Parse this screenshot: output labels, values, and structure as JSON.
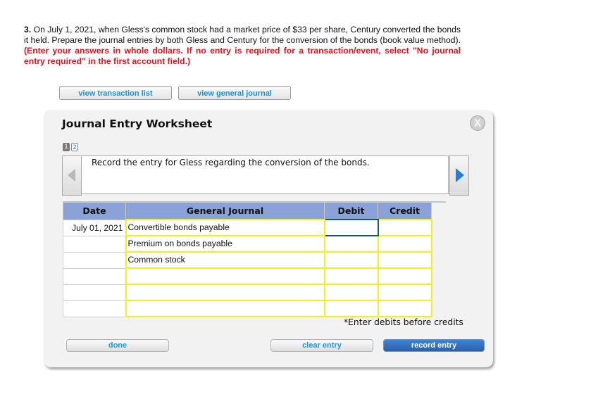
{
  "question": {
    "number": "3.",
    "text": "On July 1, 2021, when Gless's common stock had a market price of $33 per share, Century converted the bonds it held. Prepare the journal entries by both Gless and Century for the conversion of the bonds (book value method).",
    "instructions": "(Enter your answers in whole dollars. If no entry is required for a transaction/event, select \"No journal entry required\" in the first account field.)"
  },
  "top_buttons": {
    "view_transaction_list": "view transaction list",
    "view_general_journal": "view general journal"
  },
  "dialog": {
    "title": "Journal Entry Worksheet",
    "close_icon": "X",
    "pages": [
      {
        "label": "1",
        "active": true
      },
      {
        "label": "2",
        "active": false
      }
    ],
    "instruction_text": "Record the entry for Gless regarding the conversion of the bonds.",
    "table": {
      "headers": [
        "Date",
        "General Journal",
        "Debit",
        "Credit"
      ],
      "rows": [
        {
          "date": "July 01, 2021",
          "account": "Convertible bonds payable",
          "debit": "",
          "credit": ""
        },
        {
          "date": "",
          "account": "Premium on bonds payable",
          "debit": "",
          "credit": ""
        },
        {
          "date": "",
          "account": "Common stock",
          "debit": "",
          "credit": ""
        },
        {
          "date": "",
          "account": "",
          "debit": "",
          "credit": ""
        },
        {
          "date": "",
          "account": "",
          "debit": "",
          "credit": ""
        },
        {
          "date": "",
          "account": "",
          "debit": "",
          "credit": ""
        }
      ]
    },
    "hint": "*Enter debits before credits",
    "buttons": {
      "done": "done",
      "clear_entry": "clear entry",
      "record_entry": "record entry"
    }
  },
  "colors": {
    "header_blue": "#8aa2d8",
    "link_blue": "#1c8fd6",
    "warning_red": "#e8101a",
    "input_highlight": "#f0f020",
    "primary_button": "#2e5ea8"
  }
}
